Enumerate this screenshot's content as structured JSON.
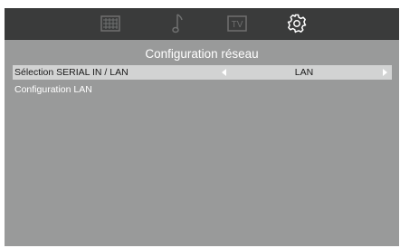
{
  "topbar": {
    "tabs": [
      {
        "icon": "picture-icon",
        "active": false
      },
      {
        "icon": "music-note-icon",
        "active": false
      },
      {
        "icon": "tv-icon",
        "active": false,
        "label": "TV"
      },
      {
        "icon": "gear-icon",
        "active": true
      }
    ]
  },
  "page": {
    "title": "Configuration réseau"
  },
  "menu": {
    "items": [
      {
        "label": "Sélection SERIAL IN / LAN",
        "value": "LAN",
        "selected": true
      },
      {
        "label": "Configuration LAN"
      }
    ]
  },
  "colors": {
    "background": "#999a9a",
    "topbar": "#3a3b3b",
    "highlight": "#d2d3d3",
    "inactive_icon": "#6f7070",
    "active_icon": "#ffffff"
  }
}
